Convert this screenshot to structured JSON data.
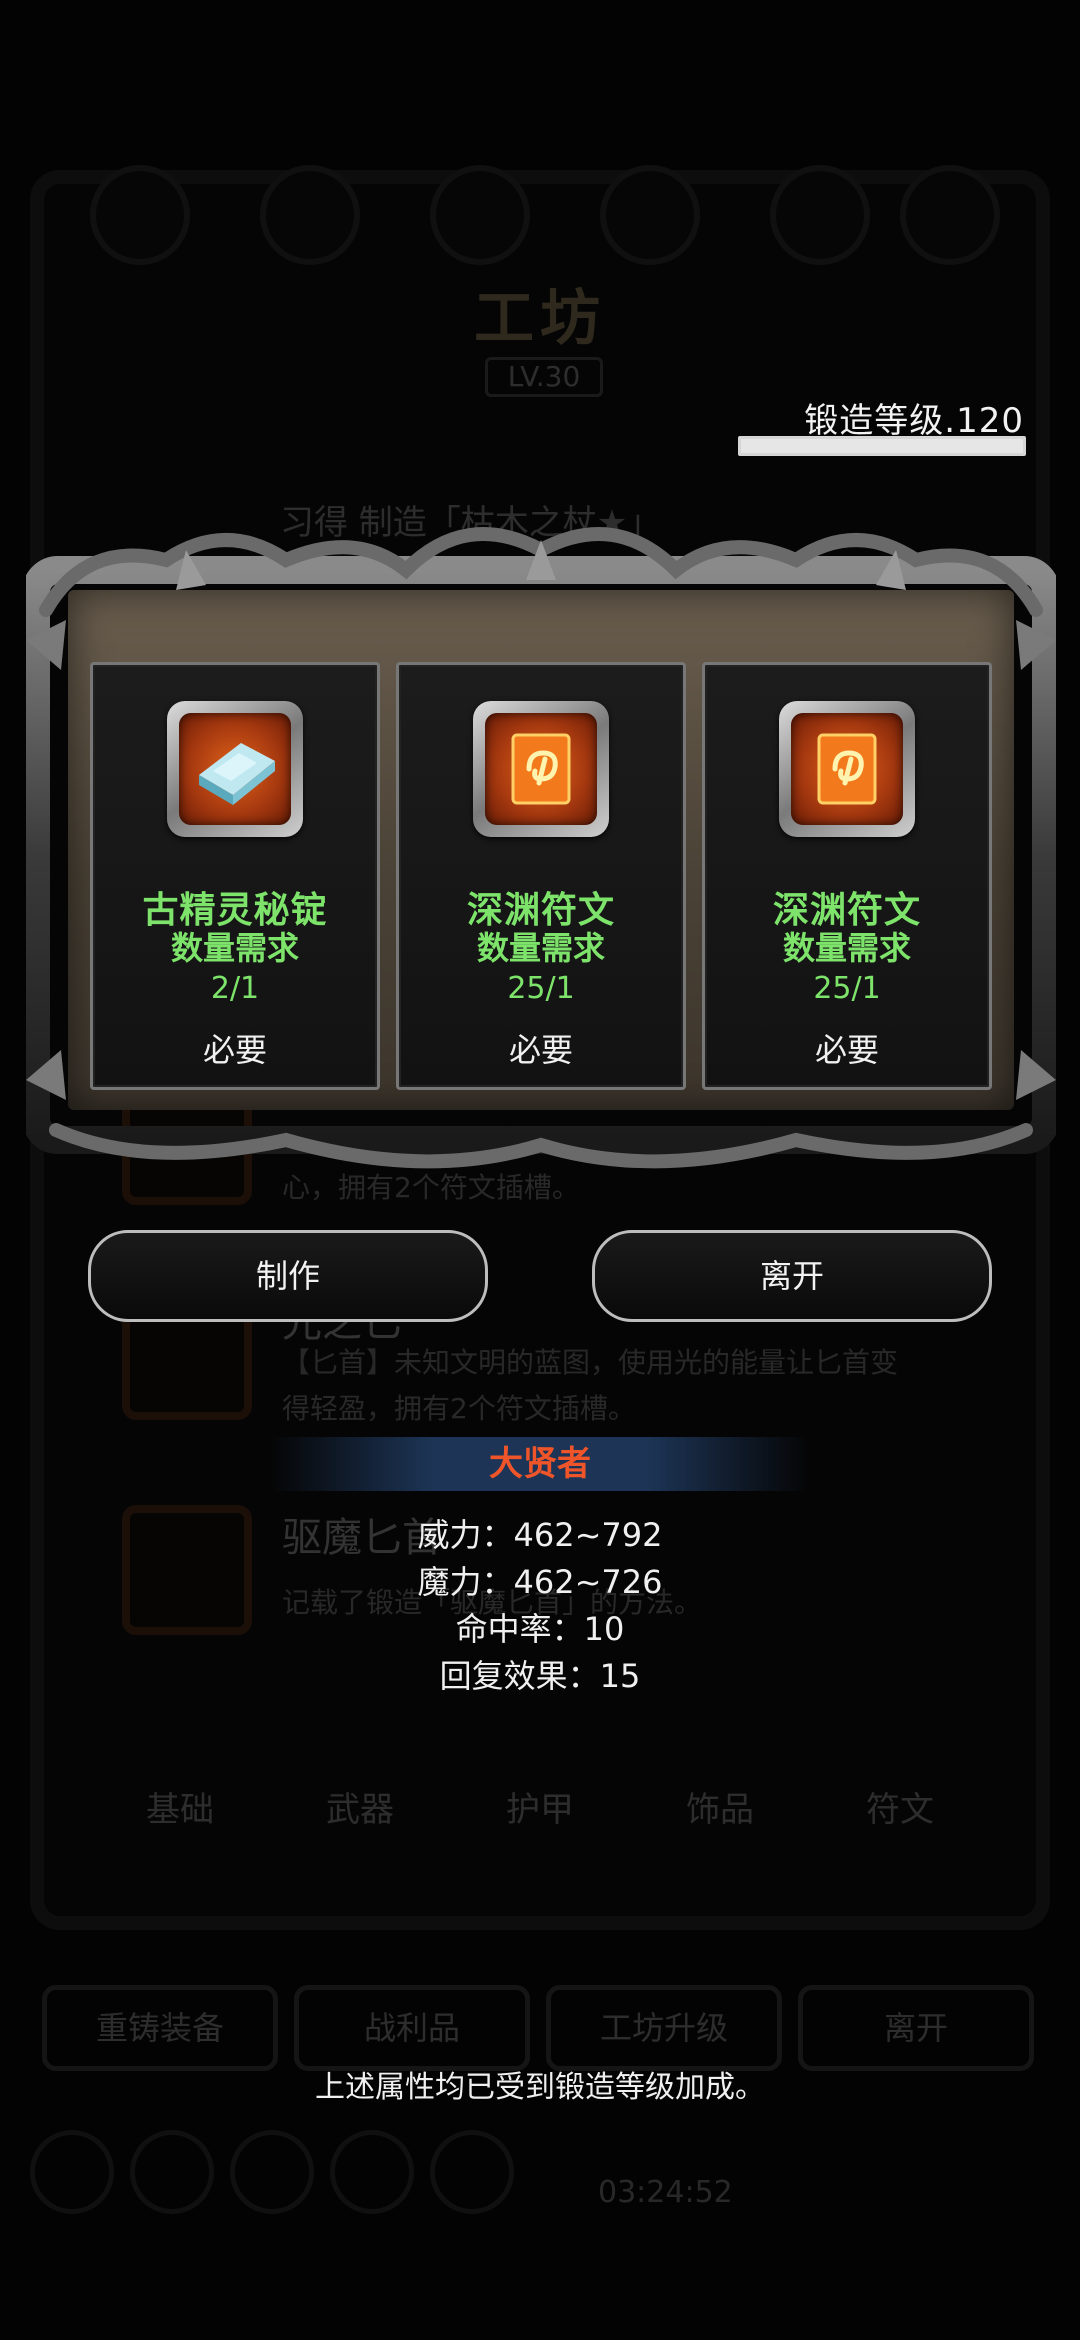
{
  "background": {
    "title": "工坊",
    "level": "LV.30",
    "recipe_title": "习得 制造「枯木之杖★」",
    "items": [
      {
        "name": "",
        "desc": "心，拥有2个符文插槽。"
      },
      {
        "name": "光之匕",
        "desc": "【匕首】未知文明的蓝图，使用光的能量让匕首变得轻盈，拥有2个符文插槽。"
      },
      {
        "name": "驱魔匕首",
        "desc": "记载了锻造「驱魔匕首」的方法。"
      }
    ],
    "tabs": [
      "基础",
      "武器",
      "护甲",
      "饰品",
      "符文"
    ],
    "bottom_buttons": [
      "重铸装备",
      "战利品",
      "工坊升级",
      "离开"
    ],
    "clock": "03:24:52"
  },
  "forge": {
    "label": "锻造等级.120",
    "progress": 1.0
  },
  "materials": [
    {
      "name": "古精灵秘锭",
      "req_label": "数量需求",
      "count": "2/1",
      "required": "必要",
      "icon": "silver-ingot-icon"
    },
    {
      "name": "深渊符文",
      "req_label": "数量需求",
      "count": "25/1",
      "required": "必要",
      "icon": "abyss-rune-icon"
    },
    {
      "name": "深渊符文",
      "req_label": "数量需求",
      "count": "25/1",
      "required": "必要",
      "icon": "abyss-rune-icon"
    }
  ],
  "buttons": {
    "craft": "制作",
    "leave": "离开"
  },
  "attributes": {
    "set_name": "大贤者",
    "stats": [
      "威力：462~792",
      "魔力：462~726",
      "命中率：10",
      "回复效果：15"
    ],
    "note": "上述属性均已受到锻造等级加成。"
  },
  "colors": {
    "material_text": "#7de36a",
    "set_name": "#f0552a"
  }
}
